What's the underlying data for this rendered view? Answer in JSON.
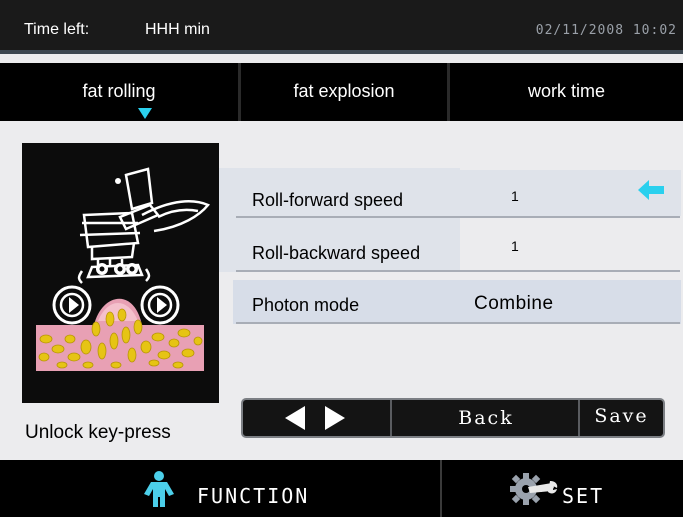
{
  "status": {
    "time_left_label": "Time left:",
    "time_left_value": "HHH min",
    "clock": "02/11/2008  10:02"
  },
  "tabs": [
    {
      "label": "fat rolling",
      "active": true
    },
    {
      "label": "fat explosion",
      "active": false
    },
    {
      "label": "work time",
      "active": false
    }
  ],
  "settings": {
    "roll_forward": {
      "label": "Roll-forward speed",
      "value": "1"
    },
    "roll_backward": {
      "label": "Roll-backward speed",
      "value": "1"
    },
    "photon_mode": {
      "label": "Photon mode",
      "value": "Combine"
    }
  },
  "unlock_label": "Unlock key-press",
  "controls": {
    "back_label": "Back",
    "save_label": "Save"
  },
  "bottom": {
    "function_label": "FUNCTION",
    "set_label": "SET"
  },
  "colors": {
    "accent": "#2ad0ee",
    "bar_background": "#000000",
    "screen_background": "#ececee"
  },
  "icons": [
    "cyan-arrow-left-icon",
    "person-icon",
    "gear-wrench-icon",
    "triangle-left-icon",
    "triangle-right-icon"
  ]
}
